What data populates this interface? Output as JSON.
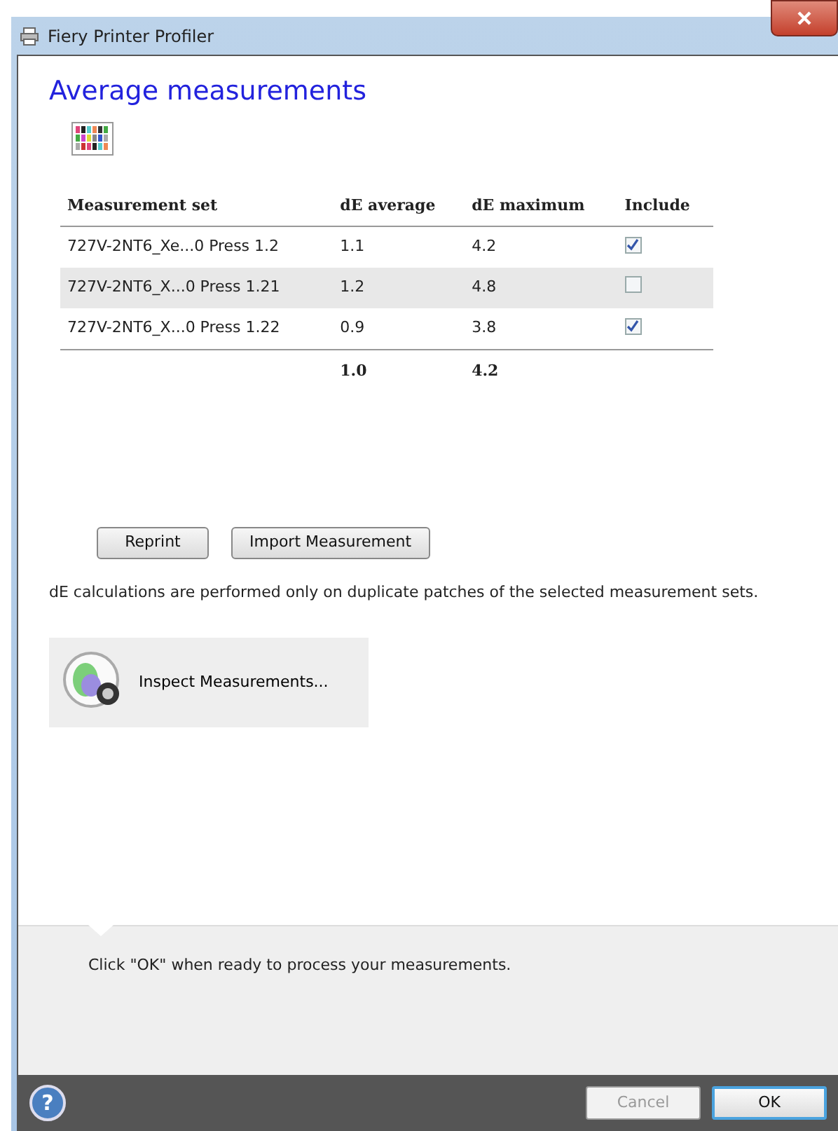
{
  "window": {
    "title": "Fiery Printer Profiler"
  },
  "heading": "Average measurements",
  "table": {
    "columns": [
      "Measurement set",
      "dE average",
      "dE maximum",
      "Include"
    ],
    "rows": [
      {
        "set": "727V-2NT6_Xe...0 Press 1.2",
        "average": "1.1",
        "maximum": "4.2",
        "included": true,
        "selected": false
      },
      {
        "set": "727V-2NT6_X...0 Press 1.21",
        "average": "1.2",
        "maximum": "4.8",
        "included": false,
        "selected": true
      },
      {
        "set": "727V-2NT6_X...0 Press 1.22",
        "average": "0.9",
        "maximum": "3.8",
        "included": true,
        "selected": false
      }
    ],
    "totals": {
      "average": "1.0",
      "maximum": "4.2"
    }
  },
  "actions": [
    "Reprint",
    "Import Measurement"
  ],
  "note": "dE calculations are performed only on duplicate patches of the selected measurement sets.",
  "inspect_button": "Inspect Measurements...",
  "message": "Click \"OK\" when ready to process your measurements.",
  "footer": {
    "help": "?",
    "buttons": [
      {
        "label": "Cancel",
        "disabled": true
      },
      {
        "label": "OK",
        "disabled": false
      }
    ]
  }
}
